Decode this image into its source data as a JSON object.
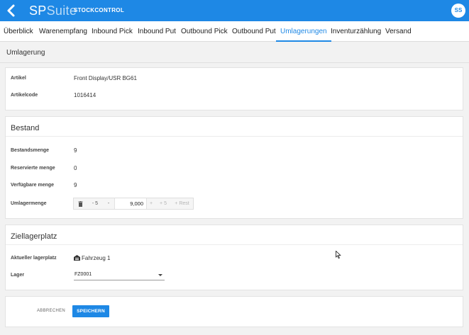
{
  "app": {
    "brand_part1": "SP",
    "brand_part2": "Suite",
    "module": "STOCKCONTROL",
    "user_initials": "SS",
    "accent_color": "#1e88e5"
  },
  "tabs": [
    {
      "label": "Überblick",
      "active": false
    },
    {
      "label": "Warenempfang",
      "active": false
    },
    {
      "label": "Inbound Pick",
      "active": false
    },
    {
      "label": "Inbound Put",
      "active": false
    },
    {
      "label": "Outbound Pick",
      "active": false
    },
    {
      "label": "Outbound Put",
      "active": false
    },
    {
      "label": "Umlagerungen",
      "active": true
    },
    {
      "label": "Inventurzählung",
      "active": false
    },
    {
      "label": "Versand",
      "active": false
    }
  ],
  "page": {
    "title": "Umlagerung"
  },
  "article": {
    "artikel_label": "Artikel",
    "artikel_value": "Front Display/USR BG61",
    "code_label": "Artikelcode",
    "code_value": "1016414"
  },
  "bestand": {
    "title": "Bestand",
    "bestandsmenge_label": "Bestandsmenge",
    "bestandsmenge_value": "9",
    "reserviert_label": "Reservierte menge",
    "reserviert_value": "0",
    "verfuegbar_label": "Verfügbare menge",
    "verfuegbar_value": "9",
    "umlager_label": "Umlagermenge",
    "stepper": {
      "trash_icon": "trash-icon",
      "minus5": "- 5",
      "minus1": "-",
      "value": "9,000",
      "plus1": "+",
      "plus5": "+ 5",
      "rest": "+ Rest"
    }
  },
  "ziellager": {
    "title": "Ziellagerplatz",
    "aktuell_label": "Aktueller lagerplatz",
    "aktuell_icon": "warehouse-icon",
    "aktuell_value": "Fahrzeug 1",
    "lager_label": "Lager",
    "lager_value": "FZ0001"
  },
  "actions": {
    "cancel": "ABBRECHEN",
    "save": "SPEICHERN"
  }
}
